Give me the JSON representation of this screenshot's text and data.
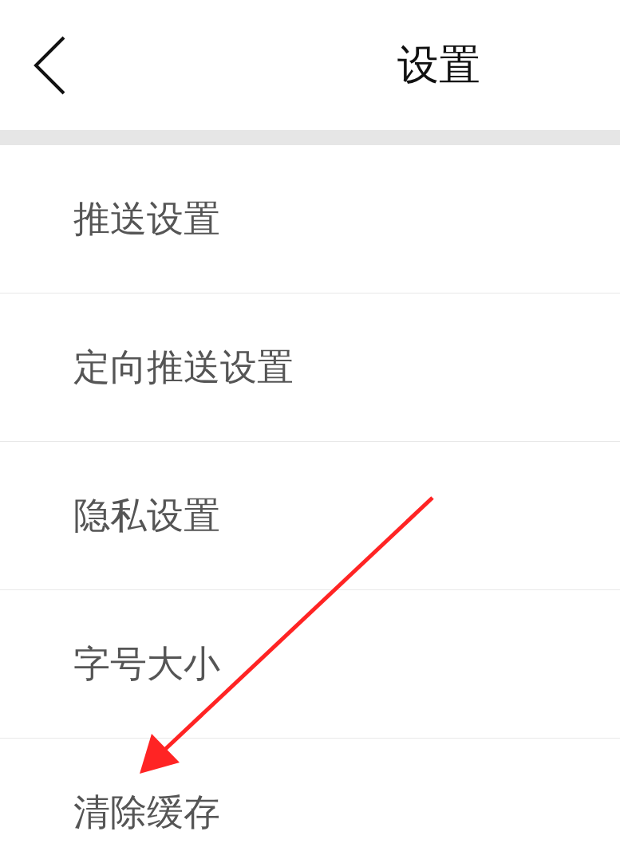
{
  "header": {
    "title": "设置"
  },
  "items": [
    {
      "label": "推送设置"
    },
    {
      "label": "定向推送设置"
    },
    {
      "label": "隐私设置"
    },
    {
      "label": "字号大小"
    },
    {
      "label": "清除缓存"
    }
  ],
  "annotation_arrow": {
    "color": "#ff2424"
  }
}
